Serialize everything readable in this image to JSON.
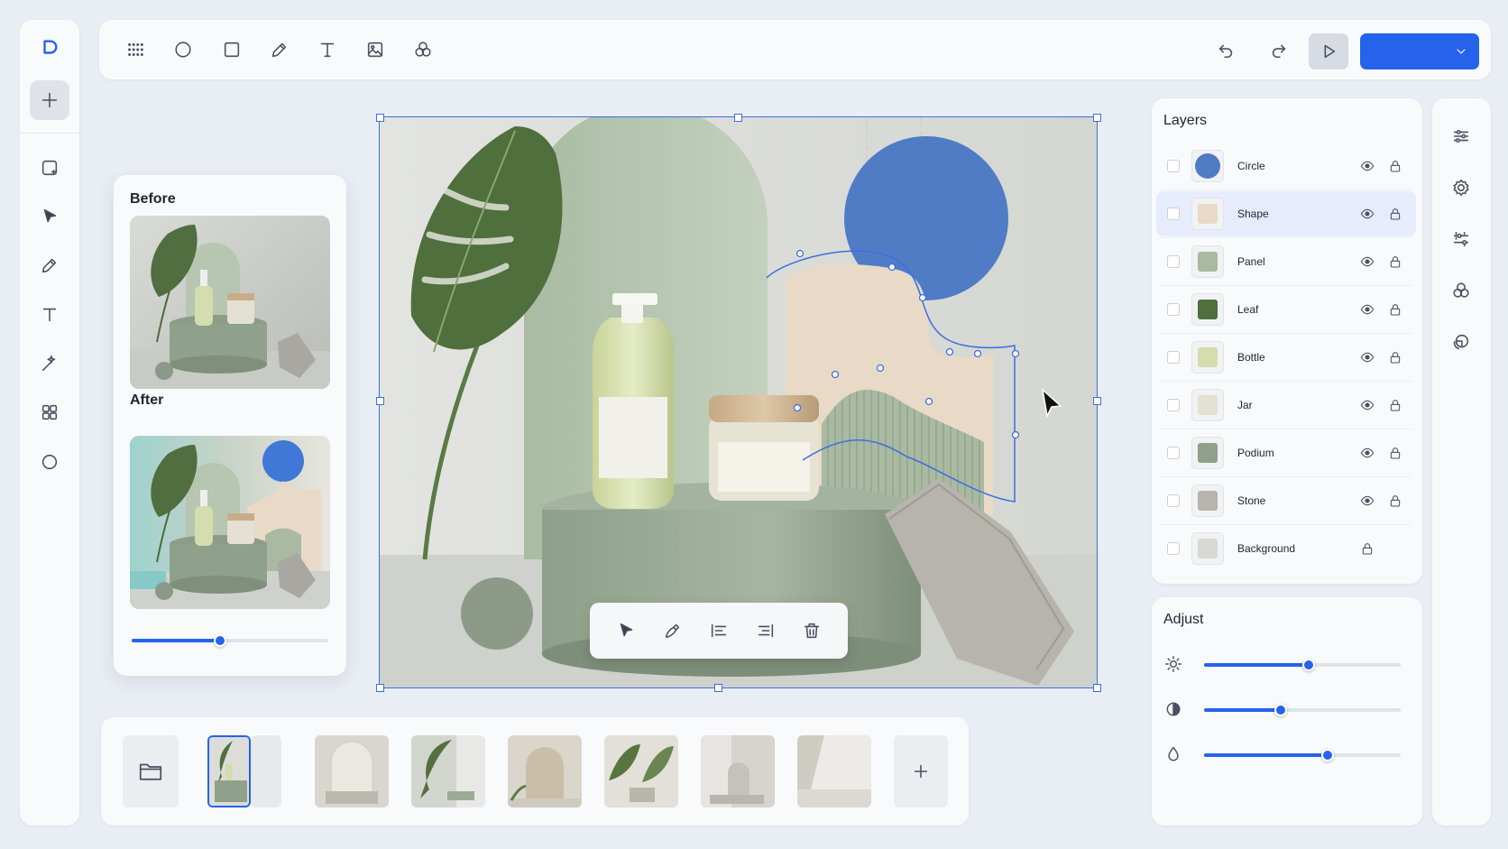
{
  "app": {
    "accent": "#2563eb",
    "logo_letter": "D"
  },
  "left_rail": {
    "items": [
      "logo-icon",
      "add-icon",
      "frame-icon",
      "select-icon",
      "pen-icon",
      "text-icon",
      "magic-icon",
      "components-icon",
      "ellipse-icon"
    ]
  },
  "toolbar": {
    "tools": [
      "grid-icon",
      "ellipse-icon",
      "rectangle-icon",
      "pencil-icon",
      "text-icon",
      "image-icon",
      "blend-icon"
    ],
    "right": [
      "undo-icon",
      "redo-icon",
      "play-icon",
      "export-dropdown"
    ]
  },
  "compare": {
    "before_label": "Before",
    "after_label": "After",
    "slider_value": 0.45
  },
  "canvas": {
    "float_tools": [
      "select-icon",
      "pen-icon",
      "align-left-icon",
      "align-right-icon",
      "trash-icon"
    ]
  },
  "layers": {
    "title": "Layers",
    "items": [
      {
        "name": "Circle",
        "visible": true,
        "locked": true
      },
      {
        "name": "Shape",
        "visible": true,
        "locked": true,
        "selected": true
      },
      {
        "name": "Panel",
        "visible": true,
        "locked": true
      },
      {
        "name": "Leaf",
        "visible": true,
        "locked": true
      },
      {
        "name": "Bottle",
        "visible": true,
        "locked": true
      },
      {
        "name": "Jar",
        "visible": true,
        "locked": true
      },
      {
        "name": "Podium",
        "visible": true,
        "locked": true
      },
      {
        "name": "Stone",
        "visible": true,
        "locked": true
      },
      {
        "name": "Background",
        "visible": false,
        "locked": true
      }
    ]
  },
  "adjust": {
    "title": "Adjust",
    "sliders": [
      {
        "icon": "brightness-icon",
        "value": 0.53
      },
      {
        "icon": "contrast-icon",
        "value": 0.39
      },
      {
        "icon": "saturation-icon",
        "value": 0.63
      }
    ]
  },
  "filmstrip": {
    "thumb_count": 7,
    "active_index": 0
  },
  "right_rail": {
    "items": [
      "sliders-icon",
      "settings-icon",
      "adjust-icon",
      "blend-icon",
      "layers-icon"
    ]
  }
}
